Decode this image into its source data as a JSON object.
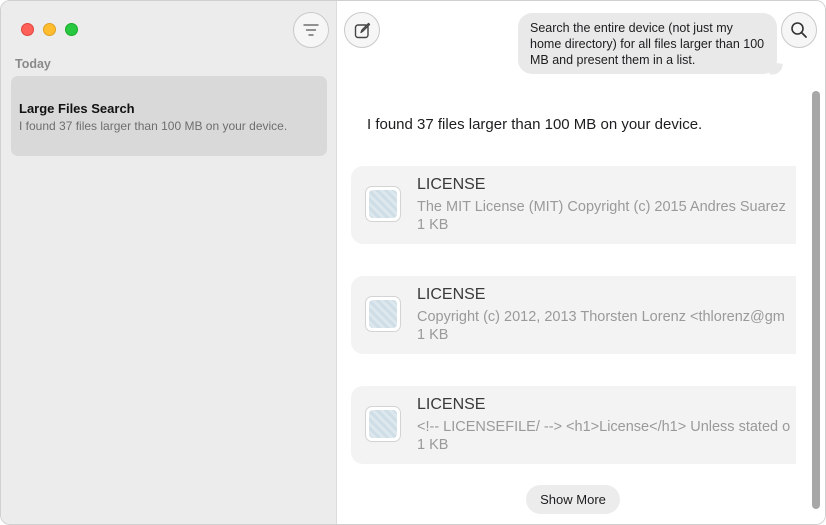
{
  "sidebar": {
    "section_label": "Today",
    "conversation": {
      "title": "Large Files Search",
      "subtitle": "I found 37 files larger than 100 MB on your device."
    }
  },
  "chat": {
    "user_message": "Search the entire device (not just my home directory) for all files larger than 100 MB and present them in a list.",
    "assistant_reply": "I found 37 files larger than 100 MB on your device.",
    "files": [
      {
        "name": "LICENSE",
        "description": "The MIT License (MIT) Copyright (c) 2015 Andres Suarez",
        "size": "1 KB"
      },
      {
        "name": "LICENSE",
        "description": "Copyright (c) 2012, 2013 Thorsten Lorenz <thlorenz@gm",
        "size": "1 KB"
      },
      {
        "name": "LICENSE",
        "description": "<!-- LICENSEFILE/ --> <h1>License</h1> Unless stated o",
        "size": "1 KB"
      }
    ],
    "show_more_label": "Show More"
  },
  "icons": {
    "filter": "filter-icon",
    "compose": "compose-icon",
    "search": "search-icon",
    "file": "file-icon"
  },
  "colors": {
    "close": "#fe5f57",
    "minimize": "#febc2e",
    "zoom": "#28c840"
  }
}
